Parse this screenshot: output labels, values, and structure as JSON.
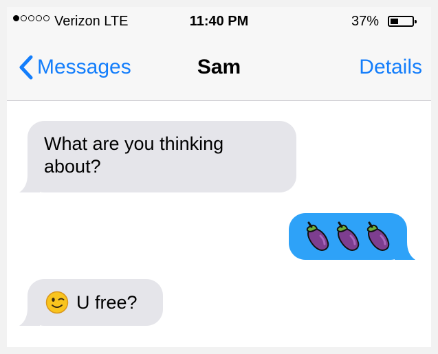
{
  "status_bar": {
    "signal_bars": 1,
    "signal_total": 5,
    "carrier": "Verizon",
    "network": "LTE",
    "time": "11:40 PM",
    "battery_percent": "37%"
  },
  "nav": {
    "back_label": "Messages",
    "title": "Sam",
    "details_label": "Details"
  },
  "messages": [
    {
      "direction": "incoming",
      "text": "What are you thinking about?"
    },
    {
      "direction": "outgoing",
      "emoji": [
        "eggplant-icon",
        "eggplant-icon",
        "eggplant-icon"
      ]
    },
    {
      "direction": "incoming",
      "emoji": "winking-face-icon",
      "text": "U free?"
    }
  ],
  "colors": {
    "accent_blue": "#147efb",
    "outgoing_bubble": "#2ea2f8",
    "incoming_bubble": "#e5e5ea"
  }
}
